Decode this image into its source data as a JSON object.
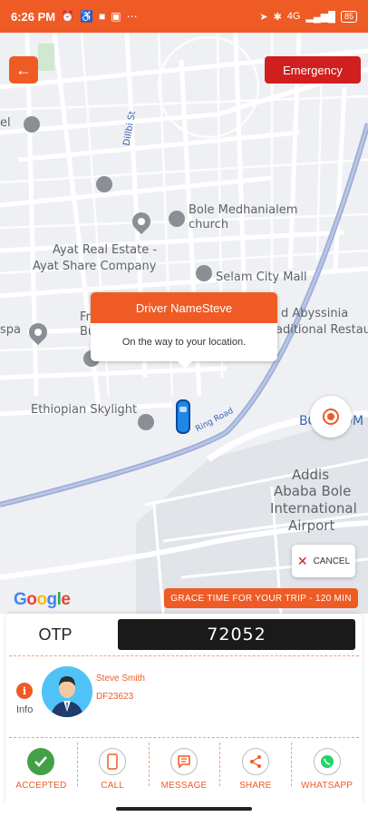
{
  "status_bar": {
    "time": "6:26 PM",
    "battery": "85",
    "signal": "4G"
  },
  "map": {
    "labels": {
      "street": "Dillbi St",
      "church": "Bole Medhanialem church",
      "real_estate_1": "Ayat Real Estate -",
      "real_estate_2": "Ayat Share Company",
      "mall": "Selam City Mall",
      "hotel_1": "d Abyssinia",
      "hotel_2": "aditional Restau",
      "spa": "spa",
      "fr": "Fr",
      "bu": "Bu",
      "skylight": "Ethiopian Skylight",
      "road": "Ring Road",
      "airport_1": "Addis",
      "airport_2": "Ababa Bole",
      "airport_3": "International",
      "airport_4": "Airport",
      "bo": "BO",
      "om": "OM",
      "el": "el"
    },
    "driver_info_title": "Driver NameSteve",
    "driver_info_status": "On the way to your location.",
    "google": "Google"
  },
  "buttons": {
    "back": "←",
    "emergency": "Emergency",
    "cancel": "CANCEL"
  },
  "grace_time": "GRACE TIME FOR YOUR TRIP - 120 MIN",
  "otp": {
    "label": "OTP",
    "value": "72052"
  },
  "driver": {
    "info_label": "Info",
    "info_icon": "i",
    "name": "Steve Smith",
    "plate": "DF23623"
  },
  "actions": [
    {
      "label": "ACCEPTED",
      "icon": "check-icon"
    },
    {
      "label": "CALL",
      "icon": "phone-icon"
    },
    {
      "label": "MESSAGE",
      "icon": "message-icon"
    },
    {
      "label": "SHARE",
      "icon": "share-icon"
    },
    {
      "label": "WHATSAPP",
      "icon": "whatsapp-icon"
    }
  ],
  "colors": {
    "accent": "#ef5b25",
    "emergency": "#d11f1f",
    "accepted": "#43a047"
  }
}
